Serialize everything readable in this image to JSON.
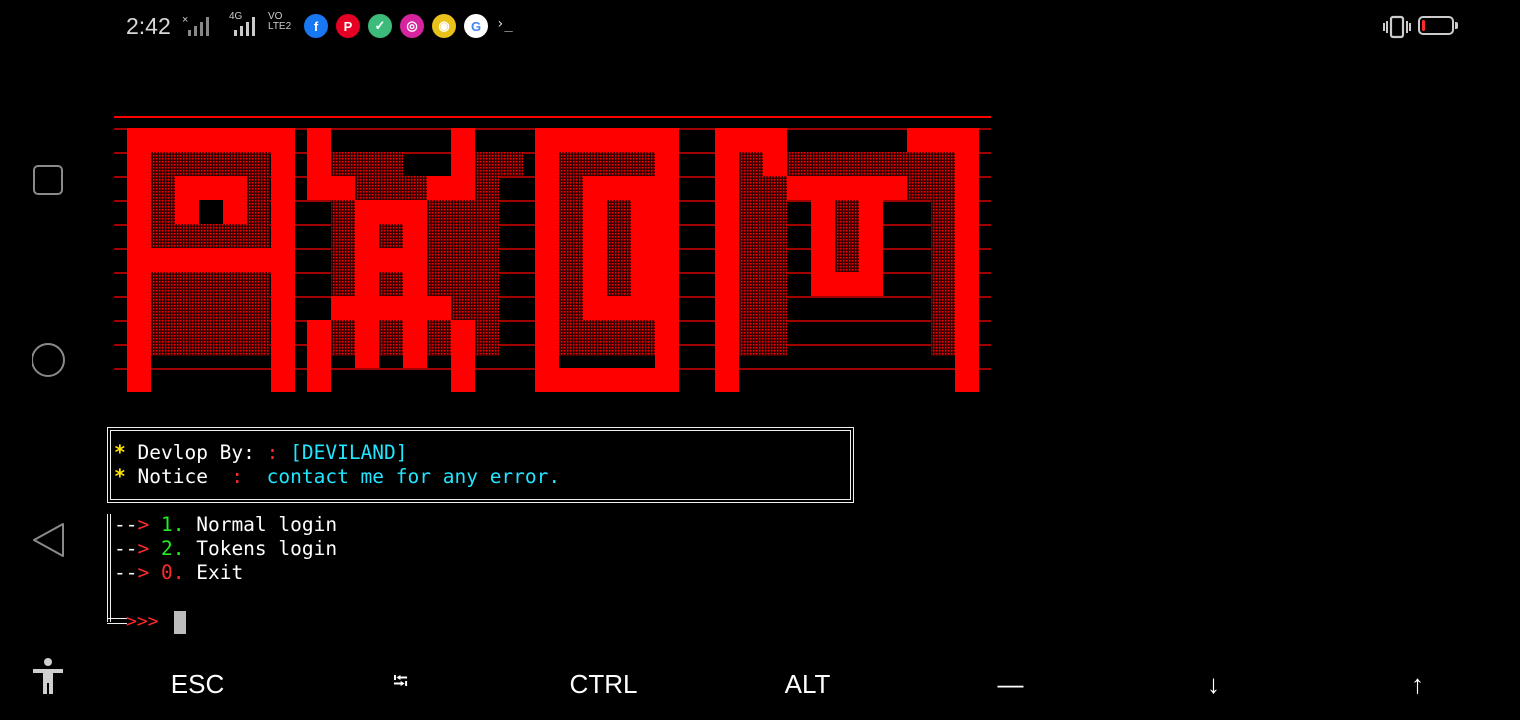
{
  "status_bar": {
    "time": "2:42",
    "net_4g": "4G",
    "net_volte": "VO\nLTE2",
    "battery_level": 0.12,
    "battery_color": "#ff2a2a",
    "notification_icons": [
      {
        "name": "facebook-icon",
        "glyph": "f",
        "color": "#1877f2"
      },
      {
        "name": "pinterest-icon",
        "glyph": "P",
        "color": "#e60023"
      },
      {
        "name": "app-green-icon",
        "glyph": "✓",
        "color": "#3dbb7a"
      },
      {
        "name": "instagram-icon",
        "glyph": "◎",
        "color": "#d6249f"
      },
      {
        "name": "chrome-icon",
        "glyph": "◉",
        "color": "#e8c11a"
      },
      {
        "name": "google-icon",
        "glyph": "G",
        "color": "#ffffff"
      }
    ],
    "terminal_glyph": "›_"
  },
  "banner": {
    "text": "AXOM",
    "color": "#ff0000"
  },
  "info_box": {
    "line1": {
      "star": "*",
      "label": " Devlop By:",
      "sep": " :",
      "value": " [DEVILAND]"
    },
    "line2": {
      "star": "*",
      "label": " Notice ",
      "sep": " :",
      "value": "  contact me for any error."
    }
  },
  "menu": {
    "arrow_dash": "--",
    "arrow_head": ">",
    "items": [
      {
        "number": "1.",
        "label": "Normal login",
        "color": "#22ee22"
      },
      {
        "number": "2.",
        "label": "Tokens login",
        "color": "#22ee22"
      },
      {
        "number": "0.",
        "label": "Exit",
        "color": "#ff2a2a"
      }
    ],
    "prompt": ">>>"
  },
  "extra_keys": [
    "ESC",
    "⭾",
    "CTRL",
    "ALT",
    "—",
    "↓",
    "↑"
  ]
}
